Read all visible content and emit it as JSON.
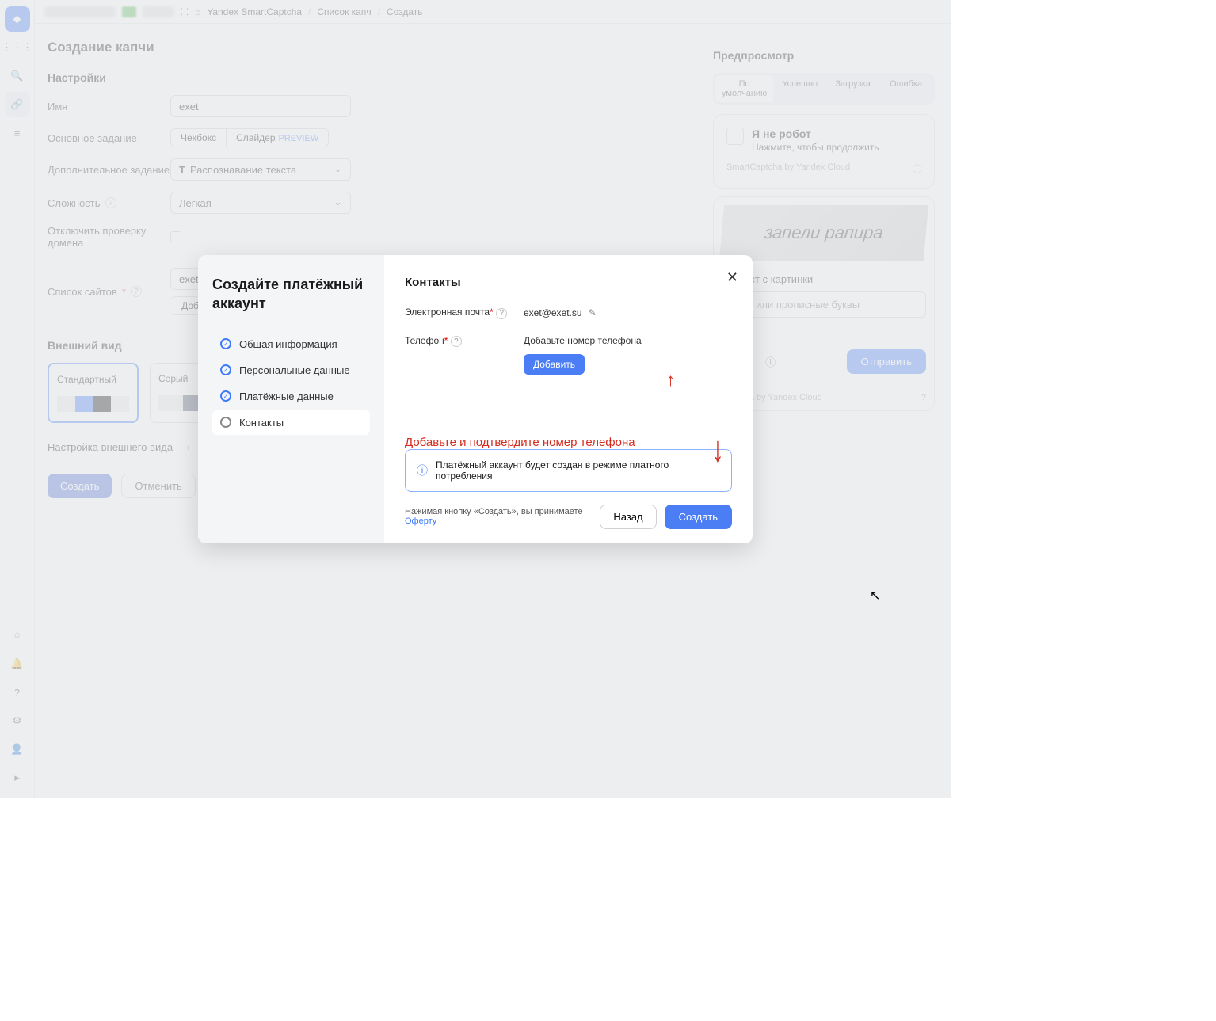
{
  "sidebar": {},
  "breadcrumbs": {
    "service": "Yandex SmartCaptcha",
    "list": "Список капч",
    "create": "Создать"
  },
  "page": {
    "title": "Создание капчи",
    "settings_heading": "Настройки",
    "appearance_heading": "Внешний вид",
    "expand_label": "Настройка внешнего вида"
  },
  "form": {
    "name_label": "Имя",
    "name_value": "exet",
    "main_task_label": "Основное задание",
    "main_task_checkbox": "Чекбокс",
    "main_task_slider": "Слайдер",
    "main_task_preview": "PREVIEW",
    "additional_task_label": "Дополнительное задание",
    "additional_task_value": "Распознавание текста",
    "difficulty_label": "Сложность",
    "difficulty_value": "Легкая",
    "disable_domain_label": "Отключить проверку домена",
    "sites_label": "Список сайтов",
    "sites_value": "exet.su",
    "add_site_btn": "Добавь"
  },
  "themes": {
    "standard": "Стандартный",
    "gray": "Серый"
  },
  "actions": {
    "create": "Создать",
    "cancel": "Отменить"
  },
  "preview": {
    "title": "Предпросмотр",
    "tab_default": "По умолчанию",
    "tab_success": "Успешно",
    "tab_loading": "Загрузка",
    "tab_error": "Ошибка",
    "not_robot": "Я не робот",
    "click_continue": "Нажмите, чтобы продолжить",
    "footer1": "SmartCaptcha by Yandex Cloud",
    "img_text": "запели рапира",
    "enter_text": "те текст с картинки",
    "placeholder": "чные или прописные буквы",
    "send": "Отправить",
    "footer2": "Captcha by Yandex Cloud"
  },
  "modal": {
    "title": "Создайте платёжный аккаунт",
    "step1": "Общая информация",
    "step2": "Персональные данные",
    "step3": "Платёжные данные",
    "step4": "Контакты",
    "section_title": "Контакты",
    "email_label": "Электронная почта",
    "email_value": "exet@exet.su",
    "phone_label": "Телефон",
    "phone_hint": "Добавьте номер телефона",
    "add_btn": "Добавить",
    "annotation": "Добавьте и подтвердите номер телефона",
    "info_text": "Платёжный аккаунт будет создан в режиме платного потребления",
    "agree_pre": "Нажимая кнопку «Создать», вы принимаете ",
    "agree_link": "Оферту",
    "back_btn": "Назад",
    "create_btn": "Создать"
  }
}
